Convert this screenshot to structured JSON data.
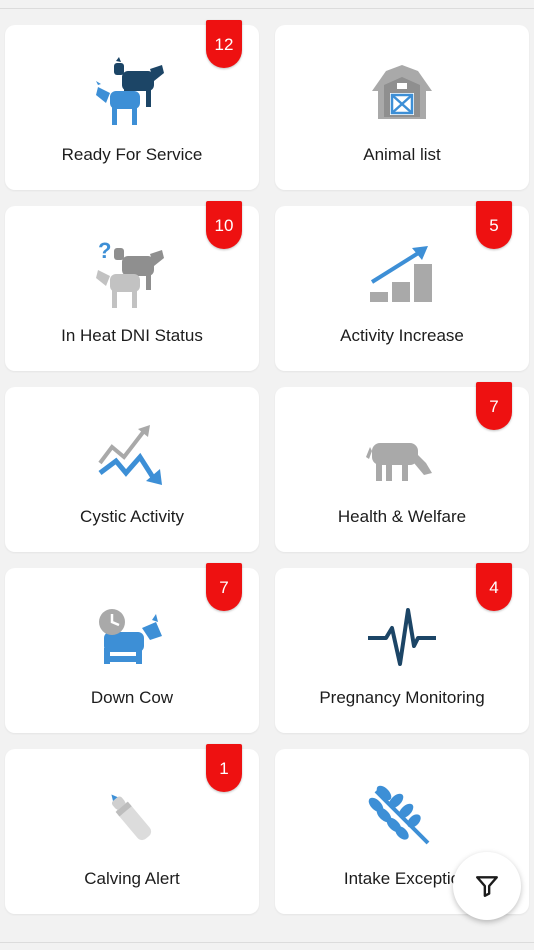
{
  "colors": {
    "badge": "#ee1111",
    "dark_blue": "#1c4566",
    "light_blue": "#3d8fd6",
    "gray": "#a9a9a9",
    "card_bg": "#ffffff",
    "page_bg": "#f2f2f2"
  },
  "cards": [
    {
      "label": "Ready For Service",
      "badge": "12",
      "icon": "two-cows-icon"
    },
    {
      "label": "Animal list",
      "badge": "",
      "icon": "barn-icon"
    },
    {
      "label": "In Heat DNI Status",
      "badge": "10",
      "icon": "cows-question-icon"
    },
    {
      "label": "Activity Increase",
      "badge": "5",
      "icon": "activity-increase-icon"
    },
    {
      "label": "Cystic Activity",
      "badge": "",
      "icon": "cystic-activity-icon"
    },
    {
      "label": "Health & Welfare",
      "badge": "7",
      "icon": "grazing-cow-icon"
    },
    {
      "label": "Down Cow",
      "badge": "7",
      "icon": "down-cow-clock-icon"
    },
    {
      "label": "Pregnancy Monitoring",
      "badge": "4",
      "icon": "heartbeat-icon"
    },
    {
      "label": "Calving Alert",
      "badge": "1",
      "icon": "bottle-icon"
    },
    {
      "label": "Intake Exceptio",
      "badge": "",
      "icon": "wheat-icon"
    }
  ],
  "fab": {
    "icon": "filter-icon"
  }
}
